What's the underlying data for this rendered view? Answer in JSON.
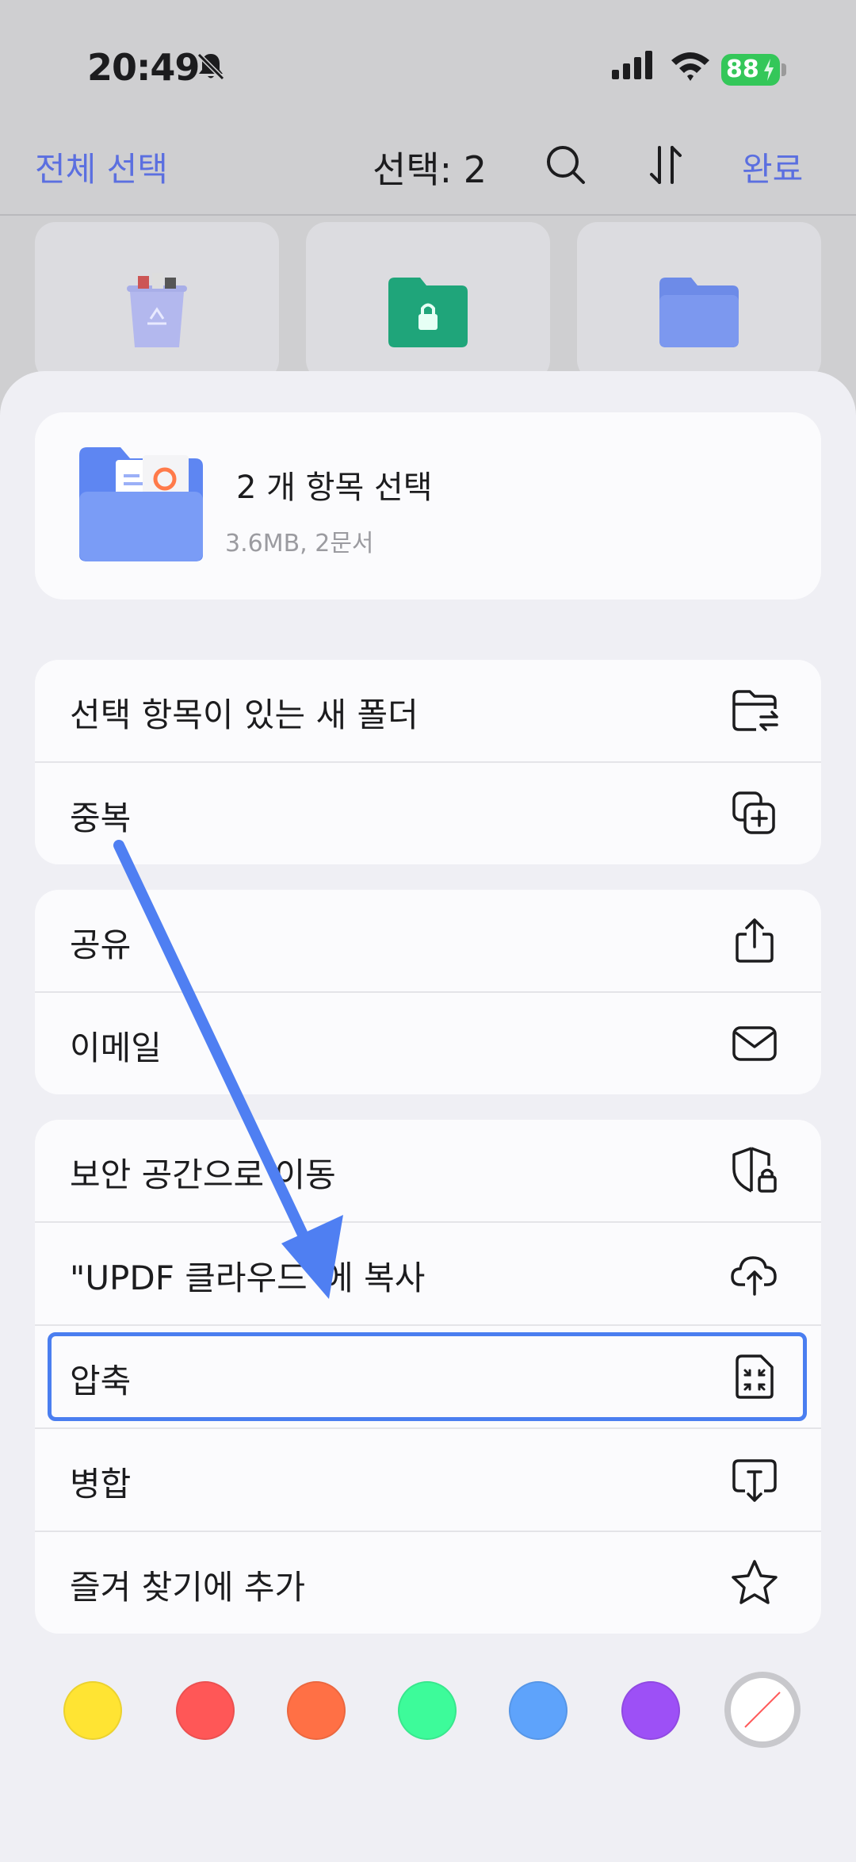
{
  "status_bar": {
    "time": "20:49",
    "battery": "88"
  },
  "nav": {
    "select_all": "전체 선택",
    "selection_count": "선택: 2",
    "done": "완료"
  },
  "summary": {
    "title": "2 개 항목 선택",
    "subtitle": "3.6MB, 2문서"
  },
  "groups": [
    {
      "items": [
        {
          "label": "선택 항목이 있는 새 폴더",
          "icon": "folder-move-icon"
        },
        {
          "label": "중복",
          "icon": "duplicate-icon"
        }
      ]
    },
    {
      "items": [
        {
          "label": "공유",
          "icon": "share-icon"
        },
        {
          "label": "이메일",
          "icon": "mail-icon"
        }
      ]
    },
    {
      "items": [
        {
          "label": "보안 공간으로 이동",
          "icon": "shield-lock-icon"
        },
        {
          "label": "\"UPDF 클라우드\"에 복사",
          "icon": "cloud-upload-icon"
        },
        {
          "label": "압축",
          "icon": "compress-icon"
        },
        {
          "label": "병합",
          "icon": "merge-icon"
        },
        {
          "label": "즐겨 찾기에 추가",
          "icon": "star-icon"
        }
      ]
    }
  ],
  "colors": {
    "accent": "#5b6fe0",
    "highlight": "#4a7ef0",
    "tag_colors": [
      "#ffe433",
      "#ff5757",
      "#ff7045",
      "#3dfb9a",
      "#5ea3fb",
      "#9d50f6"
    ]
  }
}
